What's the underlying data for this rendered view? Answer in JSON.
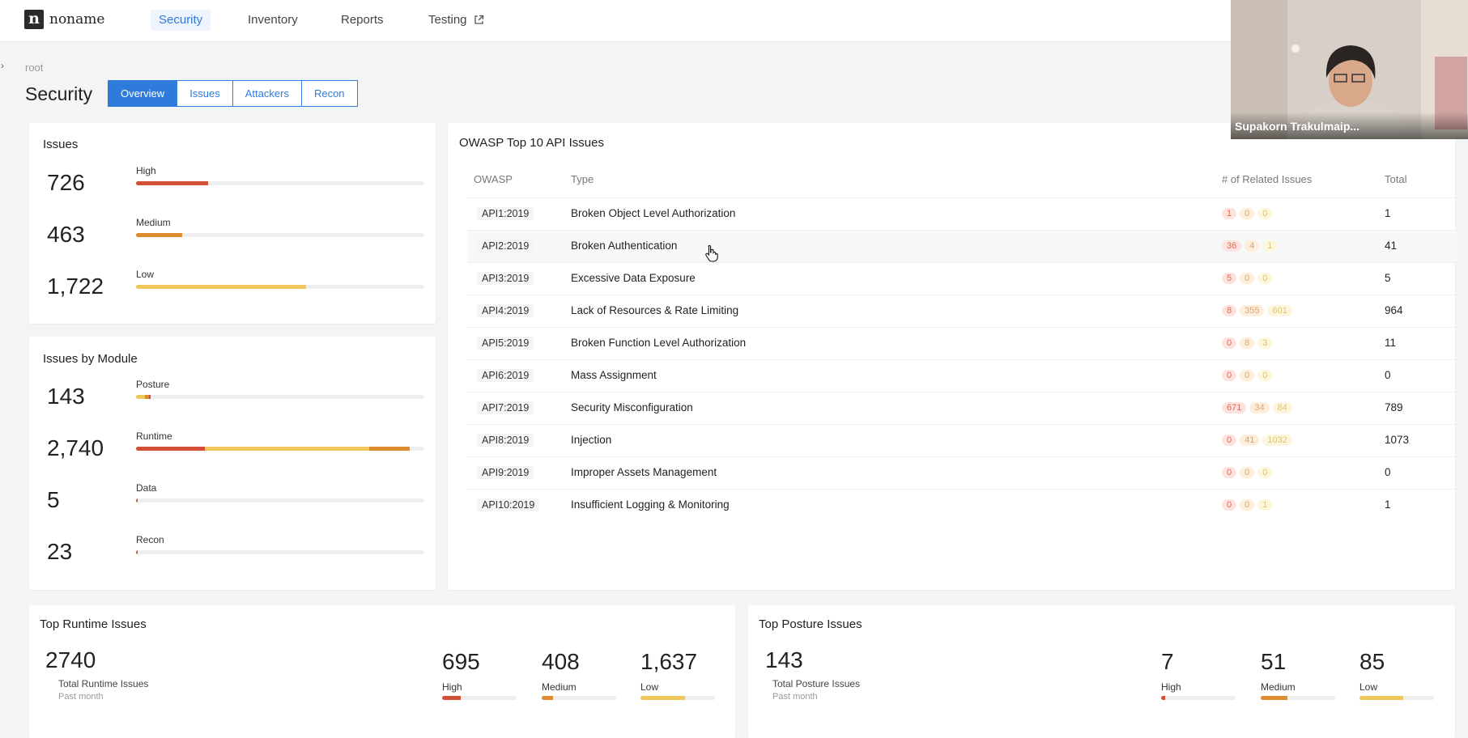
{
  "nav": {
    "logo_letter": "n",
    "logo_text": "noname",
    "items": [
      {
        "label": "Security",
        "active": true
      },
      {
        "label": "Inventory"
      },
      {
        "label": "Reports"
      },
      {
        "label": "Testing",
        "icon": "external-link-icon"
      }
    ]
  },
  "breadcrumb": "root",
  "page_title": "Security",
  "tabs": [
    {
      "label": "Overview",
      "active": true
    },
    {
      "label": "Issues"
    },
    {
      "label": "Attackers"
    },
    {
      "label": "Recon"
    }
  ],
  "issues": {
    "title": "Issues",
    "rows": [
      {
        "value": "726",
        "label": "High",
        "fill": 0.25,
        "color": "#d24e35"
      },
      {
        "value": "463",
        "label": "Medium",
        "fill": 0.16,
        "color": "#e08b2e"
      },
      {
        "value": "1,722",
        "label": "Low",
        "fill": 0.59,
        "color": "#f0c85a"
      }
    ]
  },
  "modules": {
    "title": "Issues by Module",
    "rows": [
      {
        "value": "143",
        "label": "Posture",
        "segments": [
          {
            "fill": 0.03,
            "color": "#f0c85a"
          },
          {
            "fill": 0.015,
            "color": "#e08b2e"
          },
          {
            "fill": 0.005,
            "color": "#d24e35"
          }
        ]
      },
      {
        "value": "2,740",
        "label": "Runtime",
        "segments": [
          {
            "fill": 0.24,
            "color": "#d24e35"
          },
          {
            "fill": 0.57,
            "color": "#f0c85a"
          },
          {
            "fill": 0.14,
            "color": "#e08b2e"
          }
        ]
      },
      {
        "value": "5",
        "label": "Data",
        "segments": [
          {
            "fill": 0.004,
            "color": "#d24e35"
          }
        ]
      },
      {
        "value": "23",
        "label": "Recon",
        "segments": [
          {
            "fill": 0.006,
            "color": "#d24e35"
          }
        ]
      }
    ]
  },
  "owasp": {
    "title": "OWASP Top 10 API Issues",
    "headers": {
      "owasp": "OWASP",
      "type": "Type",
      "related": "# of Related Issues",
      "total": "Total"
    },
    "rows": [
      {
        "code": "API1:2019",
        "type": "Broken Object Level Authorization",
        "high": "1",
        "medium": "0",
        "low": "0",
        "total": "1"
      },
      {
        "code": "API2:2019",
        "type": "Broken Authentication",
        "high": "36",
        "medium": "4",
        "low": "1",
        "total": "41"
      },
      {
        "code": "API3:2019",
        "type": "Excessive Data Exposure",
        "high": "5",
        "medium": "0",
        "low": "0",
        "total": "5"
      },
      {
        "code": "API4:2019",
        "type": "Lack of Resources & Rate Limiting",
        "high": "8",
        "medium": "355",
        "low": "601",
        "total": "964"
      },
      {
        "code": "API5:2019",
        "type": "Broken Function Level Authorization",
        "high": "0",
        "medium": "8",
        "low": "3",
        "total": "11"
      },
      {
        "code": "API6:2019",
        "type": "Mass Assignment",
        "high": "0",
        "medium": "0",
        "low": "0",
        "total": "0"
      },
      {
        "code": "API7:2019",
        "type": "Security Misconfiguration",
        "high": "671",
        "medium": "34",
        "low": "84",
        "total": "789"
      },
      {
        "code": "API8:2019",
        "type": "Injection",
        "high": "0",
        "medium": "41",
        "low": "1032",
        "total": "1073"
      },
      {
        "code": "API9:2019",
        "type": "Improper Assets Management",
        "high": "0",
        "medium": "0",
        "low": "0",
        "total": "0"
      },
      {
        "code": "API10:2019",
        "type": "Insufficient Logging & Monitoring",
        "high": "0",
        "medium": "0",
        "low": "1",
        "total": "1"
      }
    ]
  },
  "runtime": {
    "title": "Top Runtime Issues",
    "total": "2740",
    "total_label": "Total Runtime Issues",
    "period": "Past month",
    "high": "695",
    "high_label": "High",
    "high_fill": 0.25,
    "medium": "408",
    "medium_label": "Medium",
    "medium_fill": 0.15,
    "low": "1,637",
    "low_label": "Low",
    "low_fill": 0.6
  },
  "posture": {
    "title": "Top Posture Issues",
    "total": "143",
    "total_label": "Total Posture Issues",
    "period": "Past month",
    "high": "7",
    "high_label": "High",
    "high_fill": 0.05,
    "medium": "51",
    "medium_label": "Medium",
    "medium_fill": 0.36,
    "low": "85",
    "low_label": "Low",
    "low_fill": 0.59
  },
  "video": {
    "participant_name": "Supakorn Trakulmaip..."
  },
  "colors": {
    "accent": "#2f7bdc",
    "high": "#d24e35",
    "medium": "#e08b2e",
    "low": "#f0c85a"
  }
}
